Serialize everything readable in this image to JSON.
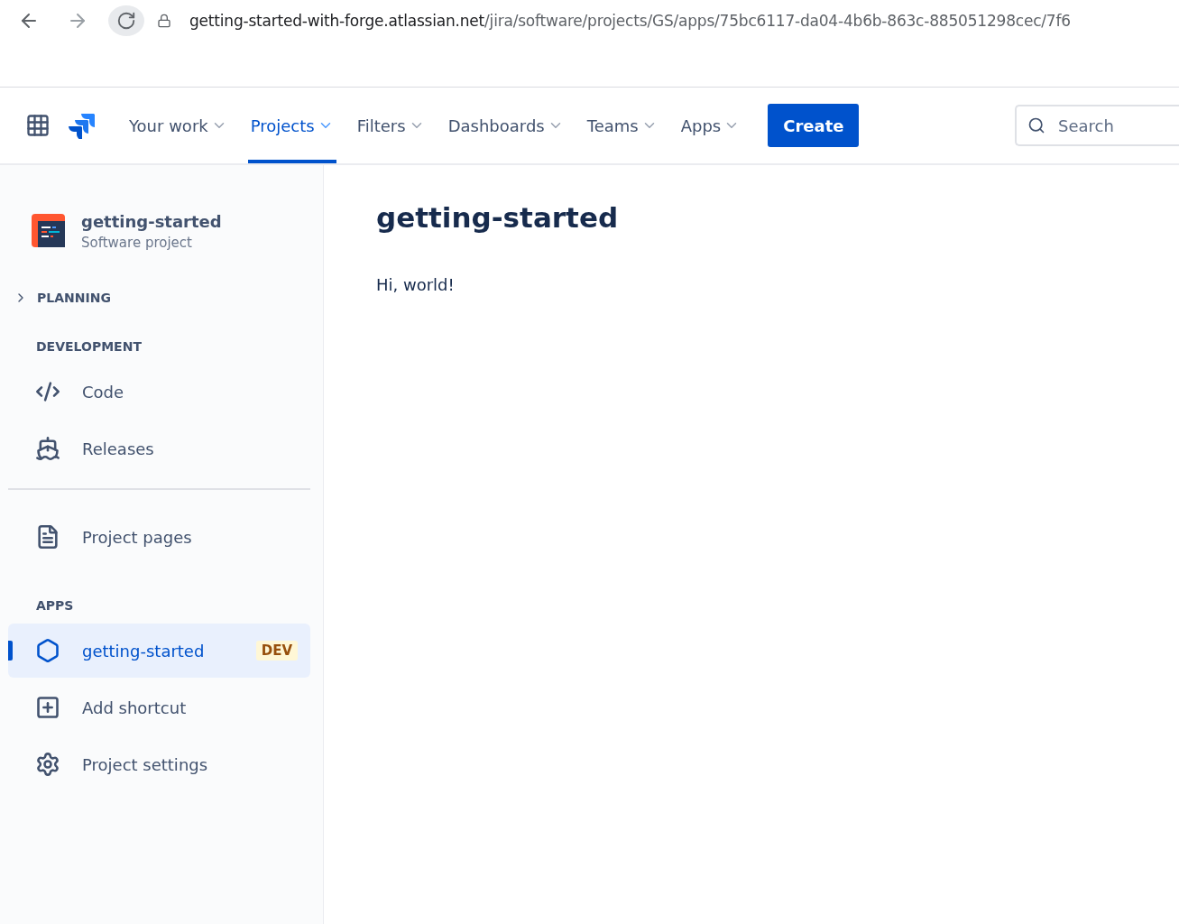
{
  "browser": {
    "url_host": "getting-started-with-forge.atlassian.net",
    "url_path": "/jira/software/projects/GS/apps/75bc6117-da04-4b6b-863c-885051298cec/7f6"
  },
  "nav": {
    "items": [
      {
        "label": "Your work",
        "selected": false
      },
      {
        "label": "Projects",
        "selected": true
      },
      {
        "label": "Filters",
        "selected": false
      },
      {
        "label": "Dashboards",
        "selected": false
      },
      {
        "label": "Teams",
        "selected": false
      },
      {
        "label": "Apps",
        "selected": false
      }
    ],
    "create": "Create",
    "search": {
      "placeholder": "Search"
    }
  },
  "sidebar": {
    "project": {
      "name": "getting-started",
      "type": "Software project"
    },
    "sections": [
      {
        "kind": "collapsible",
        "heading": "PLANNING",
        "expanded": false
      },
      {
        "kind": "group",
        "heading": "DEVELOPMENT",
        "items": [
          {
            "kind": "code",
            "label": "Code",
            "selected": false
          },
          {
            "kind": "releases",
            "label": "Releases",
            "selected": false
          }
        ]
      },
      {
        "kind": "divider"
      },
      {
        "kind": "group",
        "items": [
          {
            "kind": "pages",
            "label": "Project pages",
            "selected": false
          }
        ]
      },
      {
        "kind": "group",
        "heading": "APPS",
        "items": [
          {
            "kind": "app",
            "label": "getting-started",
            "badge": "DEV",
            "selected": true
          },
          {
            "kind": "shortcut",
            "label": "Add shortcut",
            "selected": false
          },
          {
            "kind": "settings",
            "label": "Project settings",
            "selected": false
          }
        ]
      }
    ]
  },
  "main": {
    "title": "getting-started",
    "body": "Hi, world!"
  }
}
